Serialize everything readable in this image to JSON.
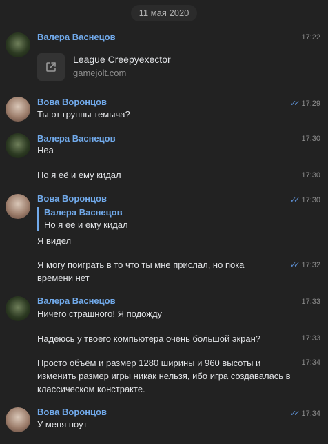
{
  "date_separator": "11 мая 2020",
  "users": {
    "valera": "Валера Васнецов",
    "vova": "Вова Воронцов"
  },
  "messages": [
    {
      "id": "m1",
      "time": "17:22",
      "link": {
        "title": "League Creepyexector",
        "domain": "gamejolt.com"
      }
    },
    {
      "id": "m2",
      "time": "17:29",
      "text": "Ты от группы темыча?"
    },
    {
      "id": "m3",
      "time": "17:30",
      "text": "Неа"
    },
    {
      "id": "m4",
      "time": "17:30",
      "text": "Но я её и ему кидал"
    },
    {
      "id": "m5",
      "time": "17:30",
      "quote": {
        "author": "Валера Васнецов",
        "text": "Но я её и ему кидал"
      },
      "text": "Я видел"
    },
    {
      "id": "m6",
      "time": "17:32",
      "text_line1": "Я могу поиграть в то что ты мне прислал, но пока",
      "text_line2": "времени нет"
    },
    {
      "id": "m7",
      "time": "17:33",
      "text": "Ничего страшного! Я подожду"
    },
    {
      "id": "m8",
      "time": "17:33",
      "text": "Надеюсь у твоего компьютера очень большой экран?"
    },
    {
      "id": "m9",
      "time": "17:34",
      "text_line1": "Просто объём и размер 1280 ширины и 960 высоты и",
      "text_line2": "изменить размер игры никак нельзя, ибо игра создавалась в",
      "text_line3": "классическом констракте."
    },
    {
      "id": "m10",
      "time": "17:34",
      "text": "У меня ноут"
    }
  ],
  "read_tick": "✓✓"
}
